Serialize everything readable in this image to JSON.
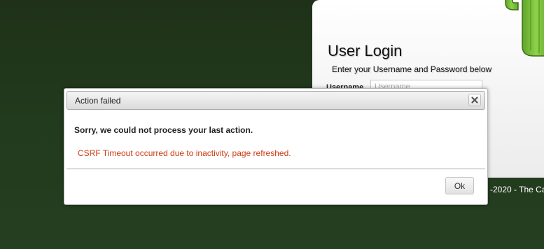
{
  "login": {
    "title": "User Login",
    "subtitle": "Enter your Username and Password below",
    "username_label": "Username",
    "username_placeholder": "Username"
  },
  "footer": {
    "text": "-2020 - The Ca"
  },
  "dialog": {
    "title": "Action failed",
    "message": "Sorry, we could not process your last action.",
    "error": "CSRF Timeout occurred due to inactivity, page refreshed.",
    "ok_label": "Ok",
    "close_icon": "close-icon"
  },
  "colors": {
    "background": "#223a1d",
    "error_text": "#cd3c14",
    "cactus": "#7cbf3a"
  },
  "icons": {
    "logo": "cactus-logo"
  }
}
